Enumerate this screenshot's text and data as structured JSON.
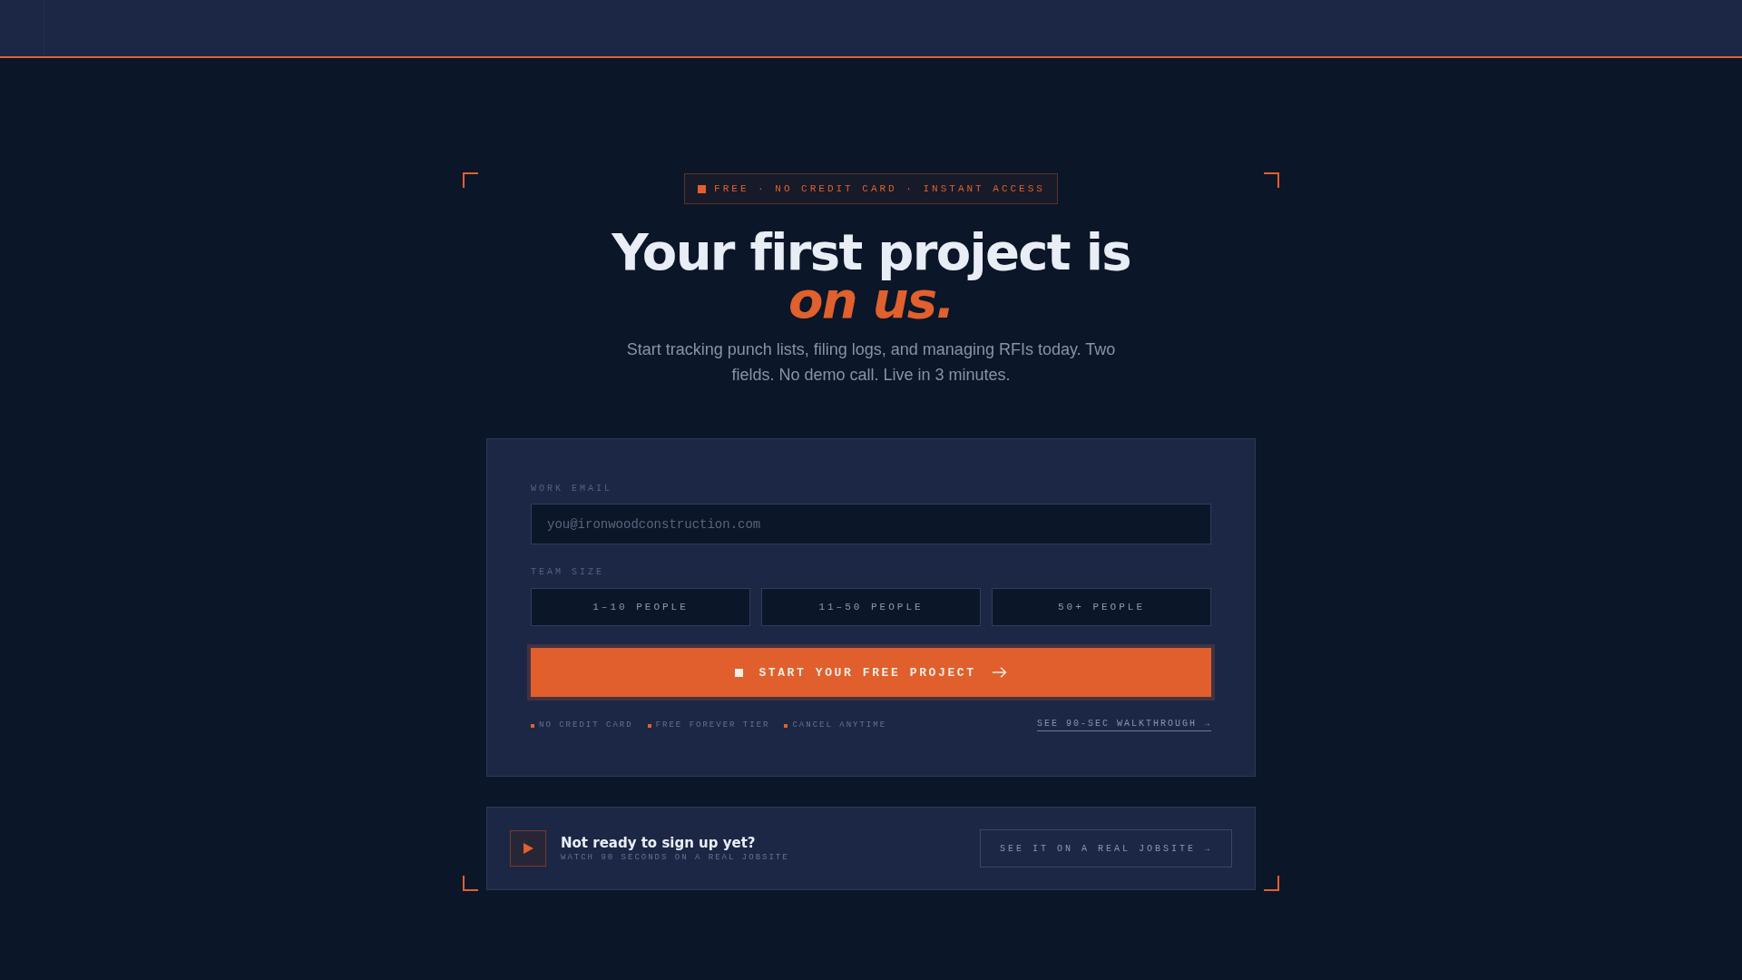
{
  "badge": {
    "text": "FREE · NO CREDIT CARD · INSTANT ACCESS"
  },
  "hero": {
    "heading": "Your first project is *on us.*",
    "subtitle": "Start tracking punch lists, filing logs, and managing RFIs today. Two fields. No demo call. Live in 3 minutes."
  },
  "signup_form": {
    "email": {
      "label": "WORK EMAIL",
      "placeholder": "you@ironwoodconstruction.com"
    },
    "team_size": {
      "label": "TEAM SIZE",
      "options": [
        {
          "label": "1–10 PEOPLE",
          "selected": false
        },
        {
          "label": "11–50 PEOPLE",
          "selected": false
        },
        {
          "label": "50+ PEOPLE",
          "selected": false
        }
      ]
    },
    "submit_button": "START YOUR FREE PROJECT",
    "perks": [
      "NO CREDIT CARD",
      "FREE FOREVER TIER",
      "CANCEL ANYTIME"
    ],
    "walkthrough_link": "SEE 90-SEC WALKTHROUGH →"
  },
  "video_prompt": {
    "title": "Not ready to sign up yet?",
    "subtitle": "WATCH 90 SECONDS ON A REAL JOBSITE",
    "button": "SEE IT ON A REAL JOBSITE →"
  }
}
